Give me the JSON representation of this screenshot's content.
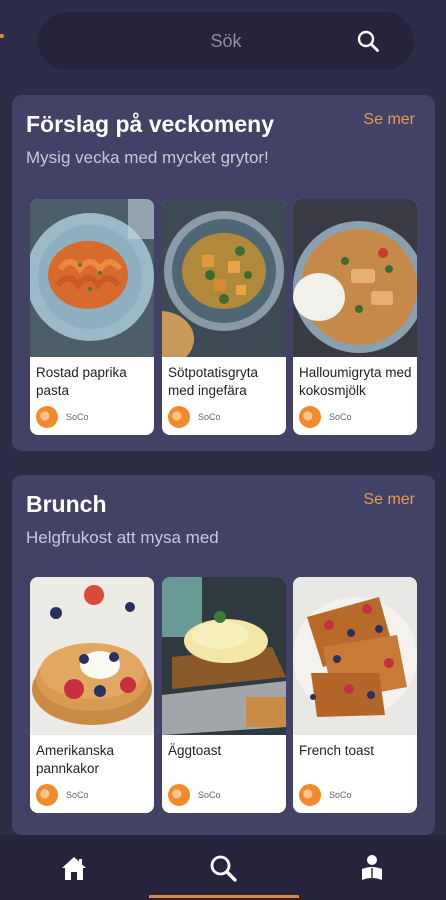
{
  "search": {
    "placeholder": "Sök"
  },
  "sections": [
    {
      "title": "Förslag på veckomeny",
      "subtitle": "Mysig vecka med mycket grytor!",
      "see_more": "Se mer",
      "cards": [
        {
          "title": "Rostad paprika pasta",
          "source": "SoCo"
        },
        {
          "title": "Sötpotatisgryta med ingefära",
          "source": "SoCo"
        },
        {
          "title": "Halloumigryta med kokosmjölk",
          "source": "SoCo"
        }
      ]
    },
    {
      "title": "Brunch",
      "subtitle": "Helgfrukost att mysa med",
      "see_more": "Se mer",
      "cards": [
        {
          "title": "Amerikanska pannkakor",
          "source": "SoCo"
        },
        {
          "title": "Äggtoast",
          "source": "SoCo"
        },
        {
          "title": "French toast",
          "source": "SoCo"
        }
      ]
    }
  ],
  "nav": {
    "items": [
      {
        "icon": "home-icon"
      },
      {
        "icon": "search-icon"
      },
      {
        "icon": "reader-icon"
      }
    ],
    "active_index": 1
  },
  "colors": {
    "background": "#2e2d48",
    "card_section": "#424166",
    "accent": "#e89a52",
    "nav_bg": "#25243c"
  }
}
